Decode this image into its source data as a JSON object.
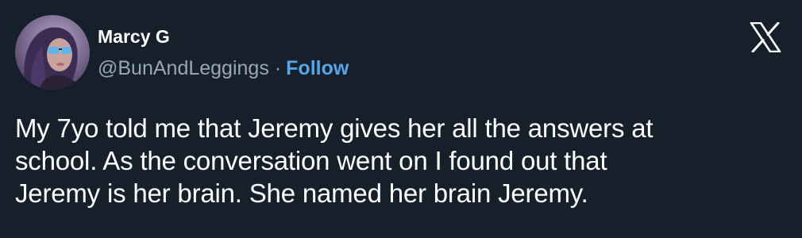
{
  "tweet": {
    "author": {
      "display_name": "Marcy G",
      "handle": "@BunAndLeggings",
      "avatar_icon": "profile-photo"
    },
    "separator": "·",
    "follow_label": "Follow",
    "brand_icon": "x-logo-icon",
    "text": "My 7yo told me that Jeremy gives her all the answers at\nschool. As the conversation went on I found out that\nJeremy is her brain. She named her brain Jeremy."
  },
  "colors": {
    "background": "#15202b",
    "text_primary": "#ffffff",
    "text_secondary": "#9aa7b3",
    "accent": "#56a6e8"
  }
}
